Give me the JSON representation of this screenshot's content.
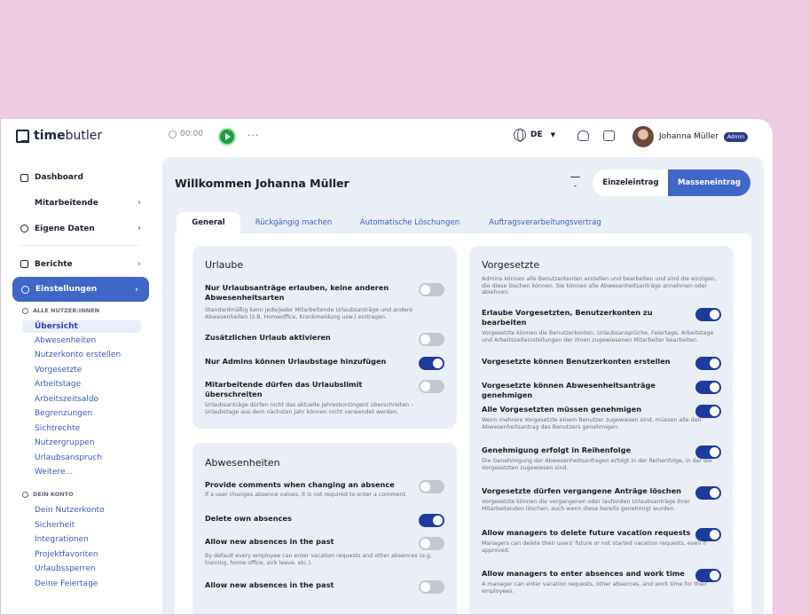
{
  "app": {
    "logo_bold": "time",
    "logo_light": "butler",
    "timer": "00:00",
    "more": "···",
    "language": "DE",
    "user_name": "Johanna Müller",
    "user_badge": "Admin"
  },
  "sidebar": {
    "items": [
      {
        "label": "Dashboard",
        "icon": "home-icon"
      },
      {
        "label": "Mitarbeitende",
        "icon": "users-icon"
      },
      {
        "label": "Eigene Daten",
        "icon": "person-icon"
      },
      {
        "label": "Berichte",
        "icon": "chart-icon"
      },
      {
        "label": "Einstellungen",
        "icon": "gear-icon"
      }
    ],
    "section_all": "ALLE NUTZER:INNEN",
    "all_items": [
      "Übersicht",
      "Abwesenheiten",
      "Nutzerkonto erstellen",
      "Vorgesetzte",
      "Arbeitstage",
      "Arbeitszeitsaldo",
      "Begrenzungen",
      "Sichtrechte",
      "Nutzergruppen",
      "Urlaubsanspruch",
      "Weitere..."
    ],
    "section_own": "DEIN KONTO",
    "own_items": [
      "Dein Nutzerkonto",
      "Sicherheit",
      "Integrationen",
      "Projektfavoriten",
      "Urlaubssperren",
      "Deine Feiertage"
    ]
  },
  "main": {
    "welcome": "Willkommen Johanna Müller",
    "btn_single": "Einzeleintrag",
    "btn_mass": "Masseneintrag",
    "tabs": [
      "General",
      "Rückgängig machen",
      "Automatische Löschungen",
      "Auftragsverarbeitungsvertrag"
    ]
  },
  "urlaube": {
    "title": "Urlaube",
    "settings": [
      {
        "label": "Nur Urlaubsanträge erlauben, keine anderen Abwesenheitsarten",
        "desc": "Standardmäßig kann jede/jeder Mitarbeitende Urlaubsanträge und andere Abwesenheiten (z.B. Homeoffice, Krankmeldung usw.) eintragen.",
        "on": false
      },
      {
        "label": "Zusätzlichen Urlaub aktivieren",
        "desc": "",
        "on": false
      },
      {
        "label": "Nur Admins können Urlaubstage hinzufügen",
        "desc": "",
        "on": true
      },
      {
        "label": "Mitarbeitende dürfen das Urlaubslimit überschreiten",
        "desc": "Urlaubsanträge dürfen nicht das aktuelle Jahreskontingent überschreiten – Urlaubstage aus dem nächsten Jahr können nicht verwendet werden.",
        "on": false
      }
    ]
  },
  "abwesenheiten": {
    "title": "Abwesenheiten",
    "settings": [
      {
        "label": "Provide comments when changing an absence",
        "desc": "If a user changes absence values, it is not required to enter a comment.",
        "on": false
      },
      {
        "label": "Delete own absences",
        "desc": "",
        "on": true
      },
      {
        "label": "Allow new absences in the past",
        "desc": "By default every employee can enter vacation requests and other absences (e.g. training, home office, sick leave, etc.).",
        "on": false
      },
      {
        "label": "Allow new absences in the past",
        "desc": "",
        "on": false
      }
    ]
  },
  "vorgesetzte": {
    "title": "Vorgesetzte",
    "intro": "Admins können alle Benutzerkonten erstellen und bearbeiten und sind die einzigen, die diese löschen können. Sie können alle Abwesenheitsanträge annehmen oder ablehnen.",
    "settings": [
      {
        "label": "Erlaube Vorgesetzten, Benutzerkonten zu bearbeiten",
        "desc": "Vorgesetzte können die Benutzerkonten, Urlaubsansprüche, Feiertage, Arbeitstage und Arbeitszeiteinstellungen der ihnen zugewiesenen Mitarbeiter bearbeiten.",
        "on": true
      },
      {
        "label": "Vorgesetzte können Benutzerkonten erstellen",
        "desc": "",
        "on": true
      },
      {
        "label": "Vorgesetzte können Abwesenheitsanträge genehmigen",
        "desc": "",
        "on": true
      },
      {
        "label": "Alle Vorgesetzten müssen genehmigen",
        "desc": "Wenn mehrere Vorgesetzte einem Benutzer zugewiesen sind, müssen alle den Abwesenheitsantrag des Benutzers genehmigen.",
        "on": true
      },
      {
        "label": "Genehmigung erfolgt in Reihenfolge",
        "desc": "Die Genehmigung der Abwesenheitsanfragen erfolgt in der Reihenfolge, in der die Vorgesetzten zugewiesen sind.",
        "on": true
      },
      {
        "label": "Vorgesetzte dürfen vergangene Anträge löschen",
        "desc": "Vorgesetzte können die vergangenen oder laufenden Urlaubsanträge ihrer Mitarbeitenden löschen, auch wenn diese bereits genehmigt wurden.",
        "on": true
      },
      {
        "label": "Allow managers to delete future vacation requests",
        "desc": "Managers can delete their users' future or not started vacation requests, even if approved.",
        "on": true
      },
      {
        "label": "Allow managers to enter absences and work time",
        "desc": "A manager can enter vacation requests, other absences, and work time for their employees.",
        "on": true
      }
    ]
  }
}
